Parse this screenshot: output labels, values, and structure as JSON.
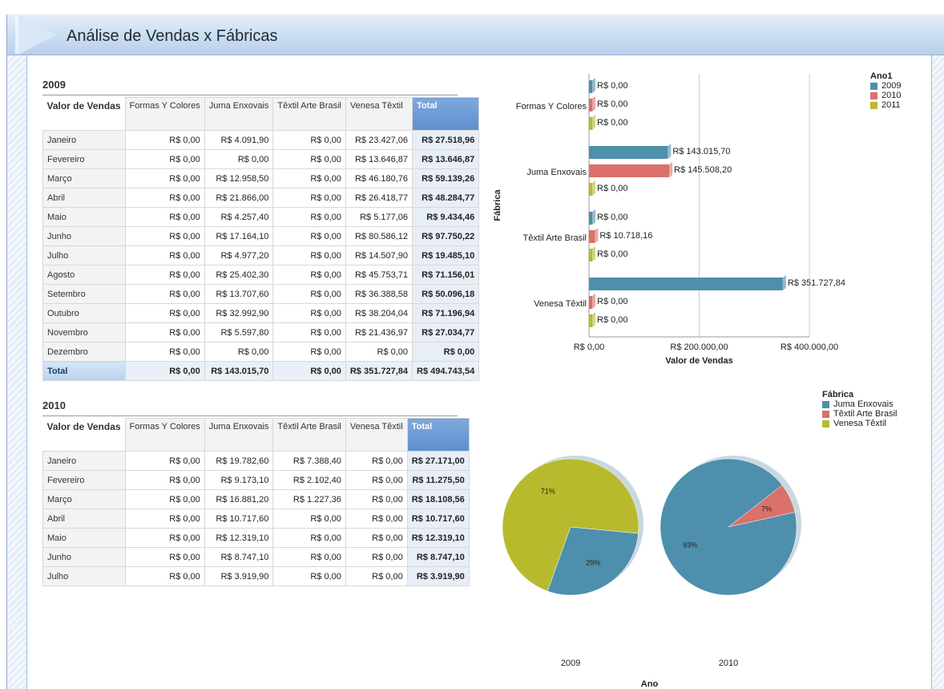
{
  "app": {
    "title": "Análise de Vendas x Fábricas"
  },
  "colors": {
    "s2009": "#4d8fad",
    "s2010": "#d9716a",
    "s2011": "#b8ba2e"
  },
  "table2009": {
    "year": "2009",
    "corner": "Valor de Vendas",
    "columns": [
      "Formas Y Colores",
      "Juma Enxovais",
      "Têxtil Arte Brasil",
      "Venesa Têxtil",
      "Total"
    ],
    "rows": [
      {
        "label": "Janeiro",
        "cells": [
          "R$ 0,00",
          "R$ 4.091,90",
          "R$ 0,00",
          "R$ 23.427,06",
          "R$ 27.518,96"
        ]
      },
      {
        "label": "Fevereiro",
        "cells": [
          "R$ 0,00",
          "R$ 0,00",
          "R$ 0,00",
          "R$ 13.646,87",
          "R$ 13.646,87"
        ]
      },
      {
        "label": "Março",
        "cells": [
          "R$ 0,00",
          "R$ 12.958,50",
          "R$ 0,00",
          "R$ 46.180,76",
          "R$ 59.139,26"
        ]
      },
      {
        "label": "Abril",
        "cells": [
          "R$ 0,00",
          "R$ 21.866,00",
          "R$ 0,00",
          "R$ 26.418,77",
          "R$ 48.284,77"
        ]
      },
      {
        "label": "Maio",
        "cells": [
          "R$ 0,00",
          "R$ 4.257,40",
          "R$ 0,00",
          "R$ 5.177,06",
          "R$ 9.434,46"
        ]
      },
      {
        "label": "Junho",
        "cells": [
          "R$ 0,00",
          "R$ 17.164,10",
          "R$ 0,00",
          "R$ 80.586,12",
          "R$ 97.750,22"
        ]
      },
      {
        "label": "Julho",
        "cells": [
          "R$ 0,00",
          "R$ 4.977,20",
          "R$ 0,00",
          "R$ 14.507,90",
          "R$ 19.485,10"
        ]
      },
      {
        "label": "Agosto",
        "cells": [
          "R$ 0,00",
          "R$ 25.402,30",
          "R$ 0,00",
          "R$ 45.753,71",
          "R$ 71.156,01"
        ]
      },
      {
        "label": "Setembro",
        "cells": [
          "R$ 0,00",
          "R$ 13.707,60",
          "R$ 0,00",
          "R$ 36.388,58",
          "R$ 50.096,18"
        ]
      },
      {
        "label": "Outubro",
        "cells": [
          "R$ 0,00",
          "R$ 32.992,90",
          "R$ 0,00",
          "R$ 38.204,04",
          "R$ 71.196,94"
        ]
      },
      {
        "label": "Novembro",
        "cells": [
          "R$ 0,00",
          "R$ 5.597,80",
          "R$ 0,00",
          "R$ 21.436,97",
          "R$ 27.034,77"
        ]
      },
      {
        "label": "Dezembro",
        "cells": [
          "R$ 0,00",
          "R$ 0,00",
          "R$ 0,00",
          "R$ 0,00",
          "R$ 0,00"
        ]
      }
    ],
    "total": {
      "label": "Total",
      "cells": [
        "R$ 0,00",
        "R$ 143.015,70",
        "R$ 0,00",
        "R$ 351.727,84",
        "R$ 494.743,54"
      ]
    }
  },
  "table2010": {
    "year": "2010",
    "corner": "Valor de Vendas",
    "columns": [
      "Formas Y Colores",
      "Juma Enxovais",
      "Têxtil Arte Brasil",
      "Venesa Têxtil",
      "Total"
    ],
    "rows": [
      {
        "label": "Janeiro",
        "cells": [
          "R$ 0,00",
          "R$ 19.782,60",
          "R$ 7.388,40",
          "R$ 0,00",
          "R$ 27.171,00"
        ]
      },
      {
        "label": "Fevereiro",
        "cells": [
          "R$ 0,00",
          "R$ 9.173,10",
          "R$ 2.102,40",
          "R$ 0,00",
          "R$ 11.275,50"
        ]
      },
      {
        "label": "Março",
        "cells": [
          "R$ 0,00",
          "R$ 16.881,20",
          "R$ 1.227,36",
          "R$ 0,00",
          "R$ 18.108,56"
        ]
      },
      {
        "label": "Abril",
        "cells": [
          "R$ 0,00",
          "R$ 10.717,60",
          "R$ 0,00",
          "R$ 0,00",
          "R$ 10.717,60"
        ]
      },
      {
        "label": "Maio",
        "cells": [
          "R$ 0,00",
          "R$ 12.319,10",
          "R$ 0,00",
          "R$ 0,00",
          "R$ 12.319,10"
        ]
      },
      {
        "label": "Junho",
        "cells": [
          "R$ 0,00",
          "R$ 8.747,10",
          "R$ 0,00",
          "R$ 0,00",
          "R$ 8.747,10"
        ]
      },
      {
        "label": "Julho",
        "cells": [
          "R$ 0,00",
          "R$ 3.919,90",
          "R$ 0,00",
          "R$ 0,00",
          "R$ 3.919,90"
        ]
      }
    ]
  },
  "chart_data": [
    {
      "type": "bar",
      "orientation": "horizontal",
      "categories": [
        "Formas Y Colores",
        "Juma Enxovais",
        "Têxtil Arte Brasil",
        "Venesa Têxtil"
      ],
      "series": [
        {
          "name": "2009",
          "values": [
            0,
            143015.7,
            0,
            351727.84
          ],
          "labels": [
            "R$ 0,00",
            "R$ 143.015,70",
            "R$ 0,00",
            "R$ 351.727,84"
          ],
          "color": "#4d8fad"
        },
        {
          "name": "2010",
          "values": [
            0,
            145508.2,
            10718.16,
            0
          ],
          "labels": [
            "R$ 0,00",
            "R$ 145.508,20",
            "R$ 10.718,16",
            "R$ 0,00"
          ],
          "color": "#d9716a"
        },
        {
          "name": "2011",
          "values": [
            0,
            0,
            0,
            0
          ],
          "labels": [
            "R$ 0,00",
            "R$ 0,00",
            "R$ 0,00",
            "R$ 0,00"
          ],
          "color": "#b8ba2e"
        }
      ],
      "xlabel": "Valor de Vendas",
      "ylabel": "Fábrica",
      "xticks": [
        "R$ 0,00",
        "R$ 200.000,00",
        "R$ 400.000,00"
      ],
      "xlim": [
        0,
        400000
      ],
      "legend_title": "Ano1",
      "legend_position": "top-right",
      "grid": true
    },
    {
      "type": "pie",
      "pies": [
        {
          "category": "2009",
          "slices": [
            {
              "name": "Juma Enxovais",
              "value": 29,
              "label": "29%"
            },
            {
              "name": "Venesa Têxtil",
              "value": 71,
              "label": "71%"
            }
          ]
        },
        {
          "category": "2010",
          "slices": [
            {
              "name": "Juma Enxovais",
              "value": 93,
              "label": "93%"
            },
            {
              "name": "Têxtil Arte Brasil",
              "value": 7,
              "label": "7%"
            }
          ]
        }
      ],
      "xlabel": "Ano",
      "legend_title": "Fábrica",
      "legend": [
        {
          "name": "Juma Enxovais",
          "color": "#4d8fad"
        },
        {
          "name": "Têxtil Arte Brasil",
          "color": "#d9716a"
        },
        {
          "name": "Venesa Têxtil",
          "color": "#b8ba2e"
        }
      ],
      "legend_position": "top-right"
    }
  ]
}
